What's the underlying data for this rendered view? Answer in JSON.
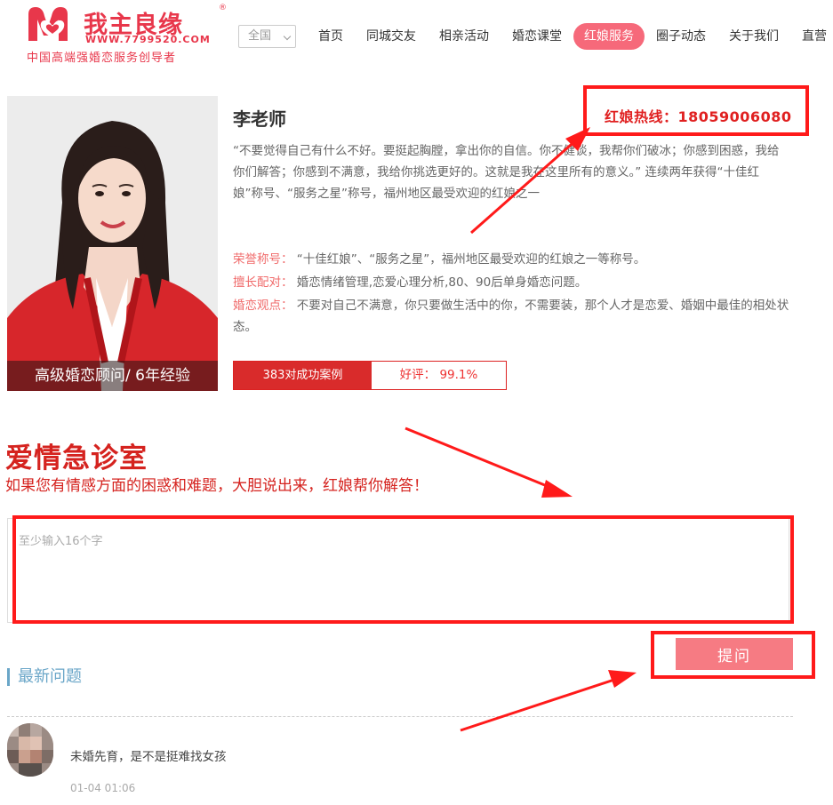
{
  "header": {
    "logo": {
      "name": "我主良缘",
      "reg_mark": "®",
      "url": "WWW.7799520.COM",
      "slogan": "中国高端强婚恋服务创导者"
    },
    "region": "全国",
    "nav": [
      "首页",
      "同城交友",
      "相亲活动",
      "婚恋课堂",
      "红娘服务",
      "圈子动态",
      "关于我们",
      "直营"
    ],
    "nav_active_index": 4
  },
  "profile": {
    "name": "李老师",
    "photo_caption": "高级婚恋顾问/ 6年经验",
    "hotline": "红娘热线：18059006080",
    "intro": "“不要觉得自己有什么不好。要挺起胸膛，拿出你的自信。你不健谈，我帮你们破冰；你感到困惑，我给你们解答；你感到不满意，我给你挑选更好的。这就是我在这里所有的意义。” 连续两年获得“十佳红娘”称号、“服务之星”称号，福州地区最受欢迎的红娘之一",
    "honors_label": "荣誉称号：",
    "honors": "“十佳红娘”、“服务之星”，福州地区最受欢迎的红娘之一等称号。",
    "specialty_label": "擅长配对：",
    "specialty": "婚恋情绪管理,恋爱心理分析,80、90后单身婚恋问题。",
    "view_label": "婚恋观点：",
    "view": "不要对自己不满意，你只要做生活中的你，不需要装，那个人才是恋爱、婚姻中最佳的相处状态。",
    "cases": "383对成功案例",
    "rating": "好评： 99.1%"
  },
  "clinic": {
    "title": "爱情急诊室",
    "subtitle": "如果您有情感方面的困惑和难题，大胆说出来，红娘帮你解答！",
    "placeholder": "至少输入16个字",
    "ask_button": "提问",
    "latest_title": "最新问题",
    "questions": [
      {
        "text": "未婚先育，是不是挺难找女孩",
        "time": "01-04 01:06"
      }
    ]
  },
  "colors": {
    "brand": "#e8374b",
    "accent_red": "#d5231f",
    "annotation": "#ff1a1a",
    "nav_active": "#f6697a",
    "ask_button": "#f67b83",
    "latest": "#6aa6c8"
  }
}
